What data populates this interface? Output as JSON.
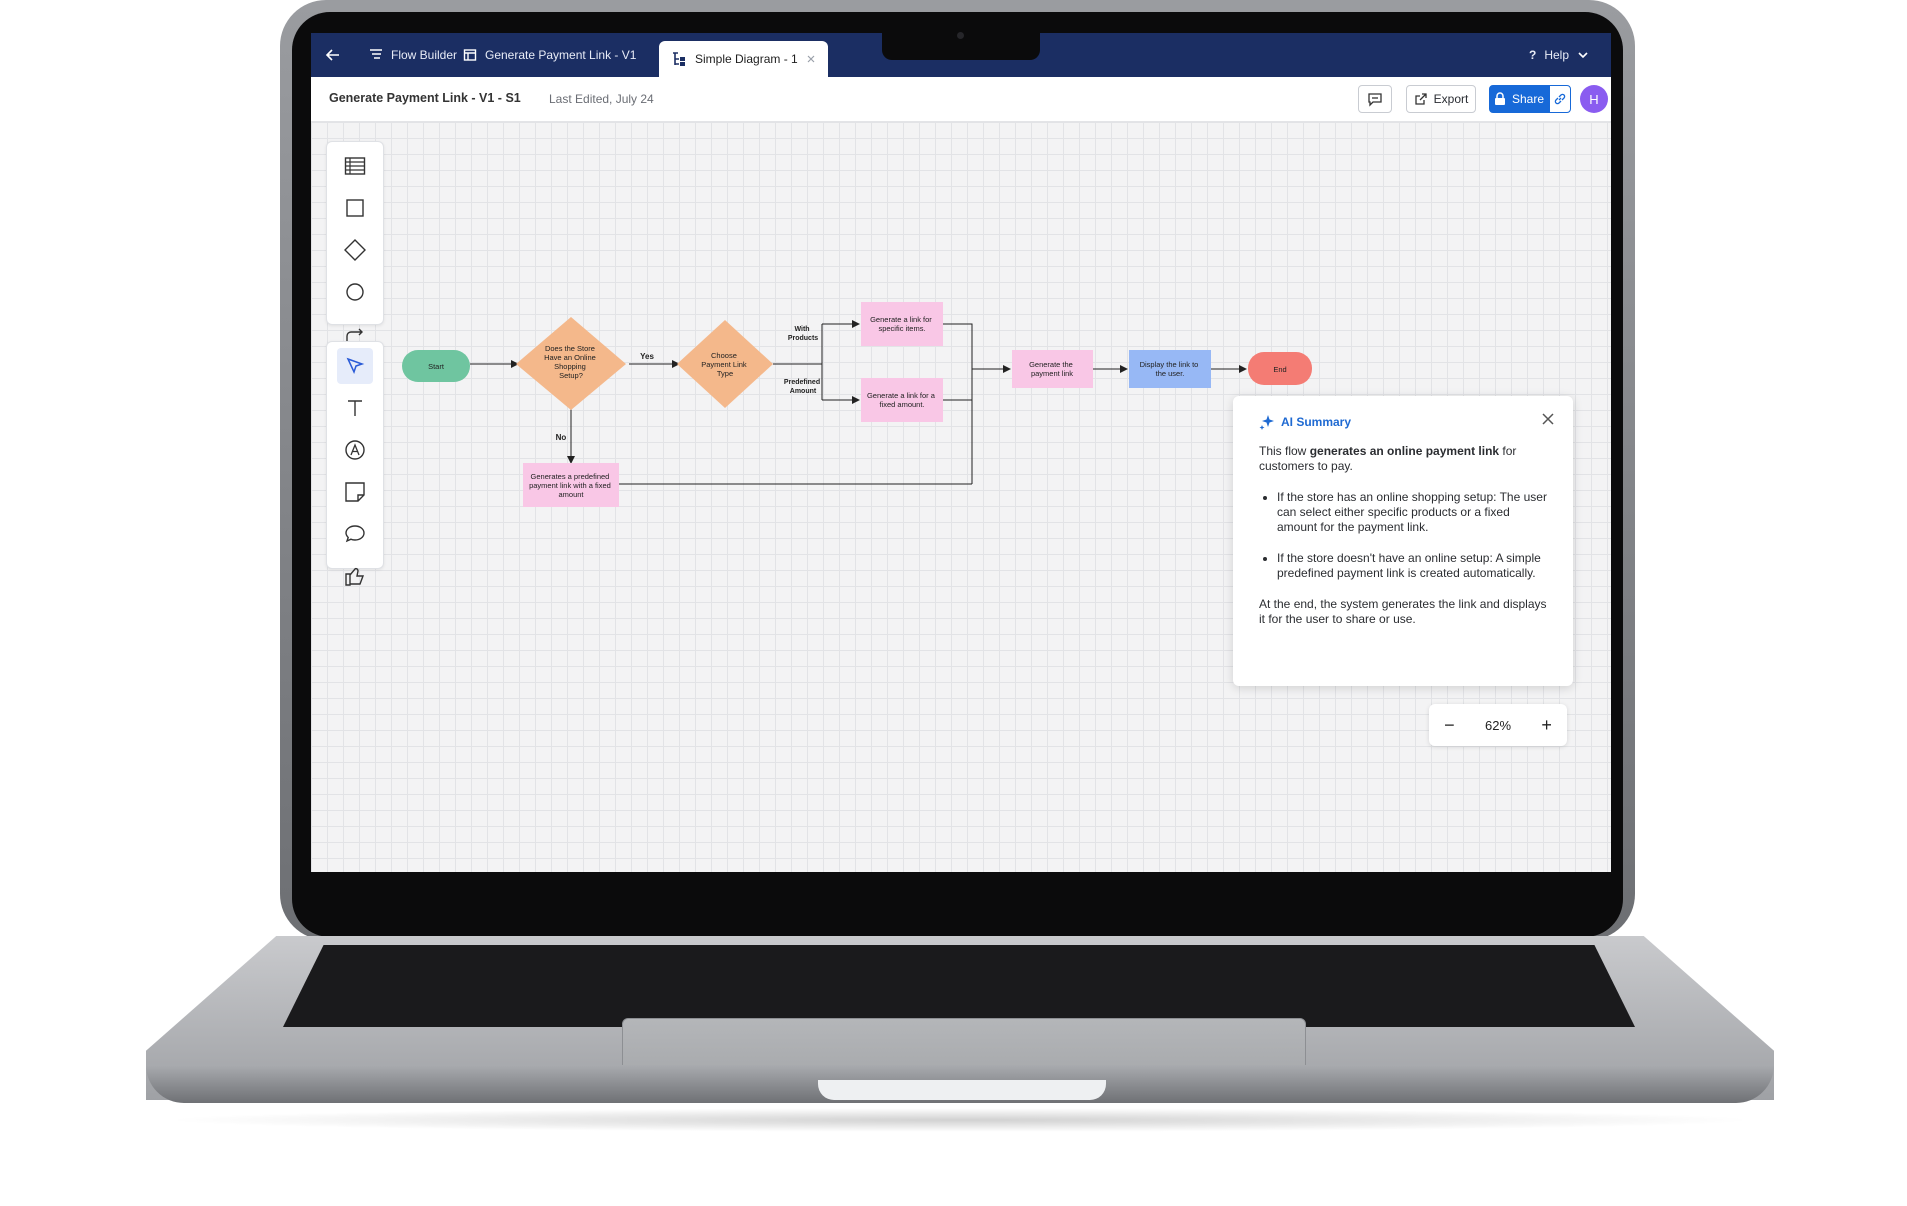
{
  "topbar": {
    "back_label": "",
    "flow_builder": "Flow Builder",
    "tab_payment": "Generate Payment Link - V1",
    "tab_diagram": "Simple Diagram - 1",
    "help": "Help"
  },
  "subbar": {
    "title": "Generate Payment Link - V1 - S1",
    "last_edited": "Last Edited, July 24",
    "export": "Export",
    "share": "Share",
    "avatar": "H"
  },
  "tools_top": [
    "table-icon",
    "rectangle-icon",
    "diamond-icon",
    "circle-icon",
    "connector-icon"
  ],
  "tools_bottom": [
    "pointer-icon",
    "text-icon",
    "pen-icon",
    "sticky-note-icon",
    "comment-icon",
    "thumbs-up-icon"
  ],
  "diagram": {
    "start": "Start",
    "decision1": [
      "Does the Store",
      "Have an Online",
      "Shopping",
      "Setup?"
    ],
    "yes": "Yes",
    "no": "No",
    "decision2": [
      "Choose",
      "Payment Link",
      "Type"
    ],
    "with_products": [
      "With",
      "Products"
    ],
    "predefined_amount": [
      "Predefined",
      "Amount"
    ],
    "specific_items": [
      "Generate a link for",
      "specific items."
    ],
    "fixed_amount": [
      "Generate a link for a",
      "fixed amount."
    ],
    "predefined_link": [
      "Generates a predefined",
      "payment link with a fixed",
      "amount"
    ],
    "generate_payment": [
      "Generate the",
      "payment link"
    ],
    "display_link": [
      "Display the link to",
      "the user."
    ],
    "end": "End",
    "colors": {
      "start": "#6fc5a0",
      "decision": "#f4b88b",
      "process": "#f9c7e6",
      "display": "#97b8f5",
      "end": "#f47c74"
    }
  },
  "ai_summary": {
    "title": "AI Summary",
    "intro_prefix": "This flow ",
    "intro_bold": "generates an online payment link",
    "intro_suffix": " for customers to pay.",
    "bullet1": "If the store has an online shopping setup: The user can select either specific products or a fixed amount for the payment link.",
    "bullet2": "If the store doesn't have an online setup: A simple predefined payment link is created automatically.",
    "outro": "At the end, the system generates the link and displays it for the user to share or use."
  },
  "zoom": {
    "value": "62%",
    "minus": "−",
    "plus": "+"
  }
}
